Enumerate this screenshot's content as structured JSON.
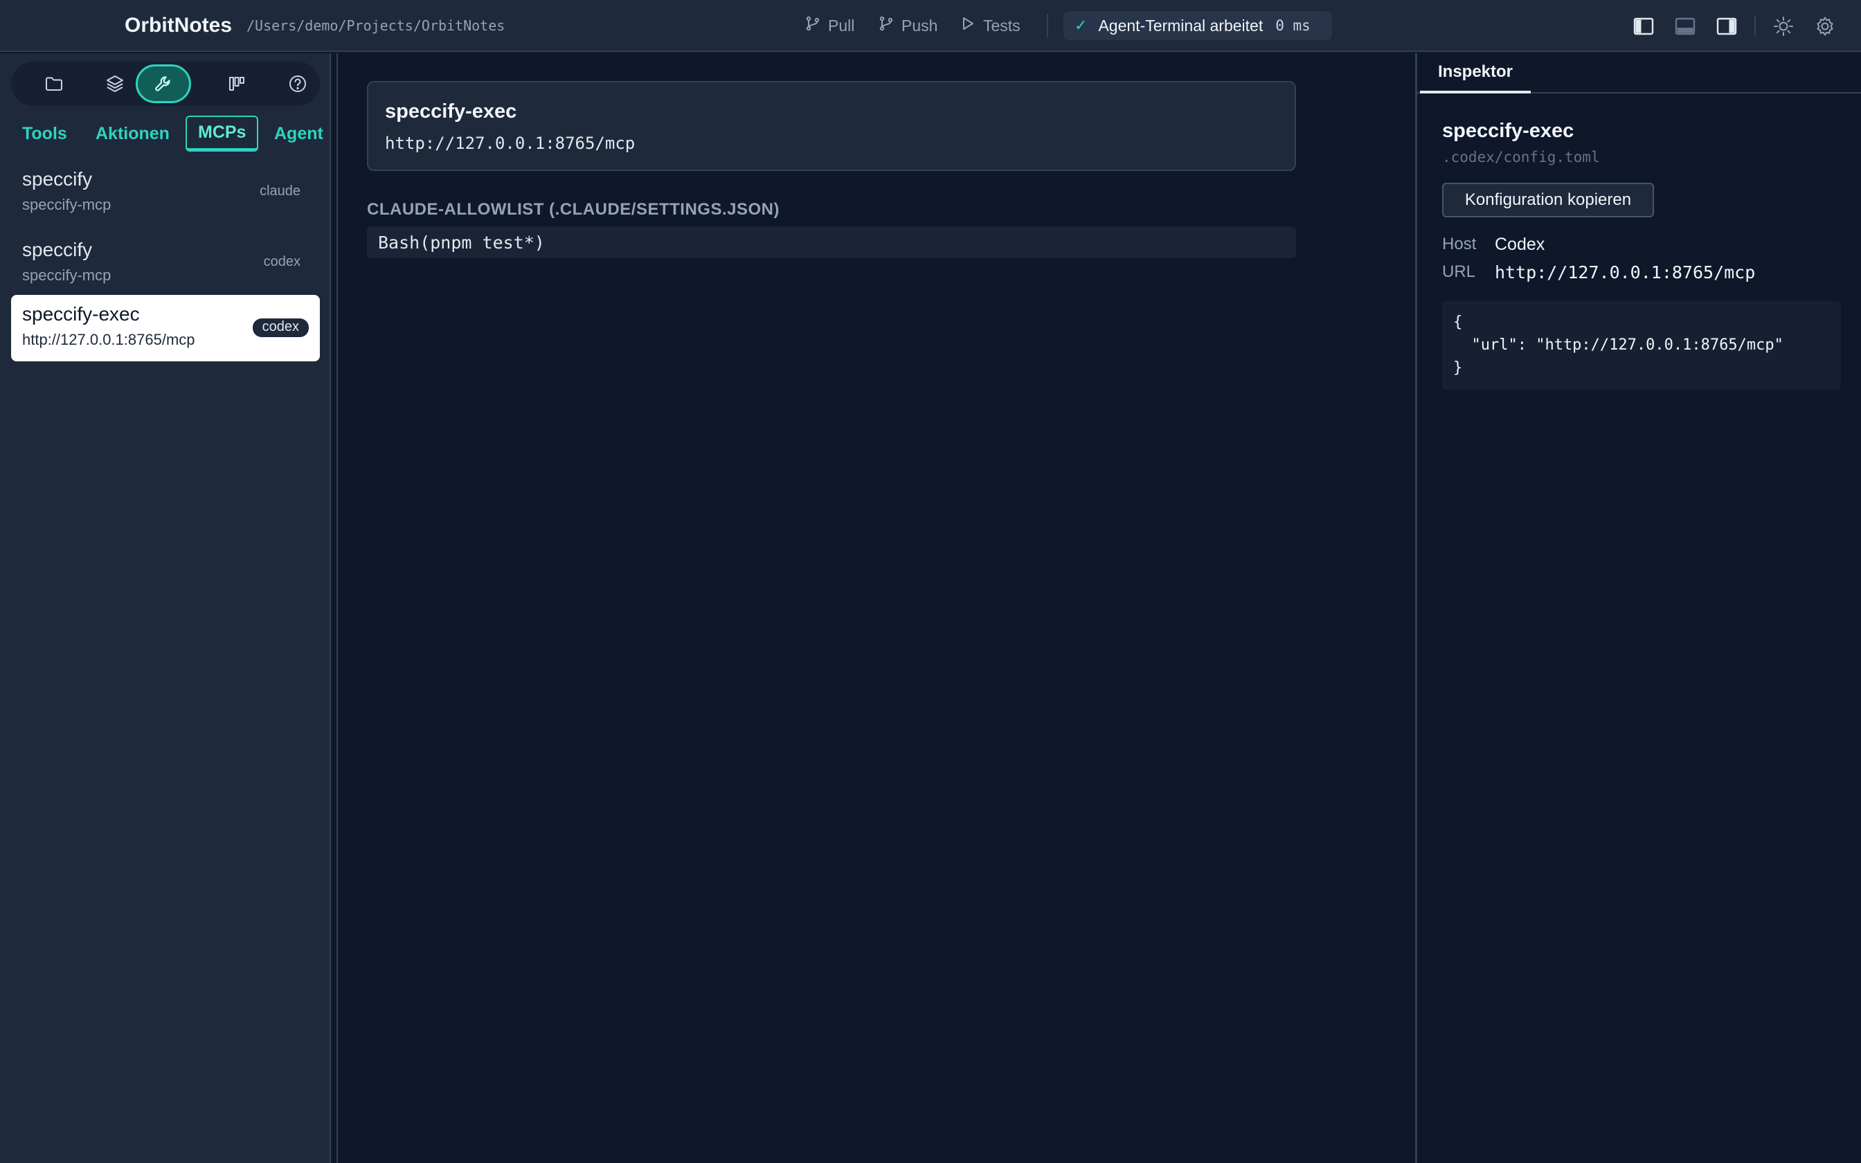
{
  "header": {
    "app_title": "OrbitNotes",
    "project_path": "/Users/demo/Projects/OrbitNotes",
    "actions": {
      "pull": "Pull",
      "push": "Push",
      "tests": "Tests"
    },
    "agent_status": {
      "label": "Agent-Terminal arbeitet",
      "duration": "0 ms",
      "icon": "check-icon"
    },
    "right_icons": [
      "layout-left-panel-icon",
      "layout-bottom-panel-icon",
      "layout-right-panel-icon",
      "sun-icon",
      "gear-icon"
    ]
  },
  "sidebar": {
    "rail_icons": [
      "folder-icon",
      "layers-icon",
      "wrench-icon",
      "kanban-icon",
      "help-icon"
    ],
    "active_rail": "wrench-icon",
    "subtabs": {
      "tools": "Tools",
      "actions": "Aktionen",
      "mcps": "MCPs",
      "agent": "Agent"
    },
    "active_subtab": "MCPs",
    "items": [
      {
        "name": "speccify",
        "sub": "speccify-mcp",
        "badge": "claude"
      },
      {
        "name": "speccify",
        "sub": "speccify-mcp",
        "badge": "codex"
      },
      {
        "name": "speccify-exec",
        "sub": "http://127.0.0.1:8765/mcp",
        "badge": "codex"
      }
    ]
  },
  "main": {
    "server_name": "speccify-exec",
    "server_url": "http://127.0.0.1:8765/mcp",
    "allowlist_heading": "CLAUDE-ALLOWLIST (.CLAUDE/SETTINGS.JSON)",
    "allowlist_entries": [
      "Bash(pnpm test*)"
    ]
  },
  "inspector": {
    "tab": "Inspektor",
    "title": "speccify-exec",
    "config_path": ".codex/config.toml",
    "copy_button": "Konfiguration kopieren",
    "host_label": "Host",
    "host_value": "Codex",
    "url_label": "URL",
    "url_value": "http://127.0.0.1:8765/mcp",
    "json_lines": [
      "{",
      "  \"url\": \"http://127.0.0.1:8765/mcp\"",
      "}"
    ]
  },
  "colors": {
    "accent": "#2dd4bf",
    "background": "#0f172a",
    "panel": "#1e293b"
  }
}
